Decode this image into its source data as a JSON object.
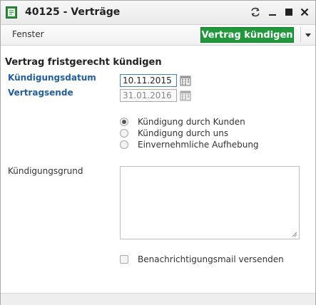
{
  "window": {
    "title": "40125 - Verträge"
  },
  "toolbar": {
    "menu_label": "Fenster",
    "primary_button_label": "Vertrag kündigen"
  },
  "form": {
    "section_title": "Vertrag fristgerecht kündigen",
    "kuendigungsdatum": {
      "label": "Kündigungsdatum",
      "value": "10.11.2015"
    },
    "vertragsende": {
      "label": "Vertragsende",
      "value": "31.01.2016"
    },
    "radio_options": [
      {
        "label": "Kündigung durch Kunden",
        "checked": true
      },
      {
        "label": "Kündigung durch uns",
        "checked": false
      },
      {
        "label": "Einvernehmliche Aufhebung",
        "checked": false
      }
    ],
    "grund": {
      "label": "Kündigungsgrund",
      "value": ""
    },
    "notify": {
      "label": "Benachrichtigungsmail versenden",
      "checked": false
    }
  },
  "colors": {
    "accent_green": "#1f9a3a",
    "label_blue": "#1f5fa6",
    "active_input_border": "#3d7fd0"
  },
  "icons": [
    "app-form-icon",
    "refresh-icon",
    "minimize-icon",
    "maximize-icon",
    "close-icon",
    "chevron-down-icon",
    "calendar-icon"
  ]
}
